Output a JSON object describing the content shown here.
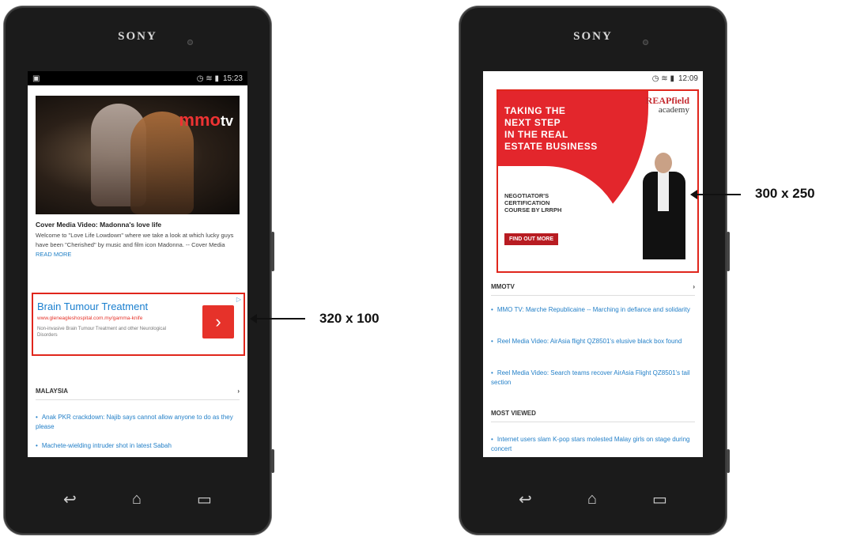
{
  "left_phone": {
    "brand": "SONY",
    "status": {
      "time": "15:23",
      "icons": "▣ ✉"
    },
    "article": {
      "video_logo": "mmo",
      "video_logo_suffix": "tv",
      "title": "Cover Media Video: Madonna's love life",
      "body": "Welcome to \"Love Life Lowdown\" where we take a look at which lucky guys have been \"Cherished\" by music and film icon Madonna. -- Cover Media",
      "read_more": "READ MORE"
    },
    "ad": {
      "title": "Brain Tumour Treatment",
      "url": "www.gleneagleshospital.com.my/gamma-knife",
      "description": "Non-invasive Brain Tumour Treatment and other Neurological Disorders",
      "button": "›",
      "choice": "▷"
    },
    "section": {
      "title": "MALAYSIA",
      "chevron": "›"
    },
    "news": [
      "Anak PKR crackdown: Najib says cannot allow anyone to do as they please",
      "Machete-wielding intruder shot in latest Sabah"
    ],
    "nav": {
      "back": "↩",
      "home": "⌂",
      "recent": "▭"
    }
  },
  "right_phone": {
    "brand": "SONY",
    "status": {
      "time": "12:09",
      "icons": "▢ 📶 ▭"
    },
    "ad": {
      "headline_lines": [
        "TAKING THE",
        "NEXT STEP",
        "IN THE REAL",
        "ESTATE BUSINESS"
      ],
      "subtitle_lines": [
        "NEGOTIATOR'S",
        "CERTIFICATION",
        "COURSE BY LRRPH"
      ],
      "cta": "FIND OUT MORE",
      "brand_name": "REAPfield",
      "brand_sub": "academy"
    },
    "section1": {
      "title": "MMOTV",
      "chevron": "›"
    },
    "news1": [
      "MMO TV: Marche Republicaine -- Marching in defiance and solidarity",
      "Reel Media Video: AirAsia flight QZ8501's elusive black box found",
      "Reel Media Video: Search teams recover AirAsia Flight QZ8501's tail section"
    ],
    "section2": {
      "title": "MOST VIEWED"
    },
    "news2": [
      "Internet users slam K-pop stars molested Malay girls on stage during concert"
    ],
    "nav": {
      "back": "↩",
      "home": "⌂",
      "recent": "▭"
    }
  },
  "annotations": {
    "small_ad_size": "320 x 100",
    "big_ad_size": "300 x 250"
  }
}
